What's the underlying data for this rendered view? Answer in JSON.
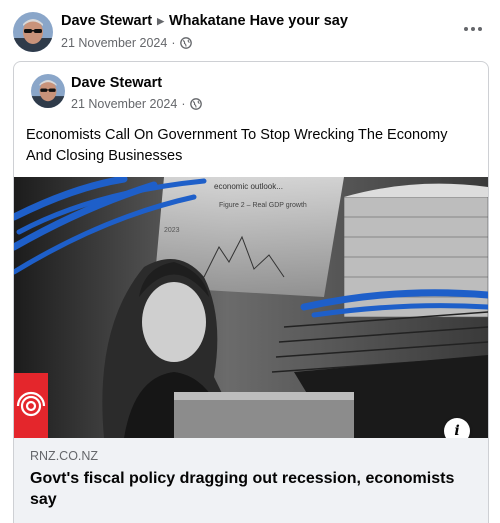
{
  "post": {
    "author": "Dave Stewart",
    "group": "Whakatane Have your say",
    "date": "21 November 2024",
    "more_icon": "more-horizontal-icon"
  },
  "shared": {
    "author": "Dave Stewart",
    "date": "21 November 2024",
    "text": "Economists Call On Government To Stop Wrecking The Economy And Closing Businesses"
  },
  "link": {
    "image_caption_text": "economic outlook...",
    "image_figure_text": "Figure 2 – Real GDP growth",
    "image_ticker_text": "2023",
    "domain": "RNZ.CO.NZ",
    "title": "Govt's fiscal policy dragging out recession, economists say"
  },
  "colors": {
    "secondary_text": "#65676b",
    "card_border": "#ced0d4",
    "link_meta_bg": "#f0f2f5",
    "rnz_red": "#e4262c",
    "scribble_blue": "#1e5fc9"
  }
}
